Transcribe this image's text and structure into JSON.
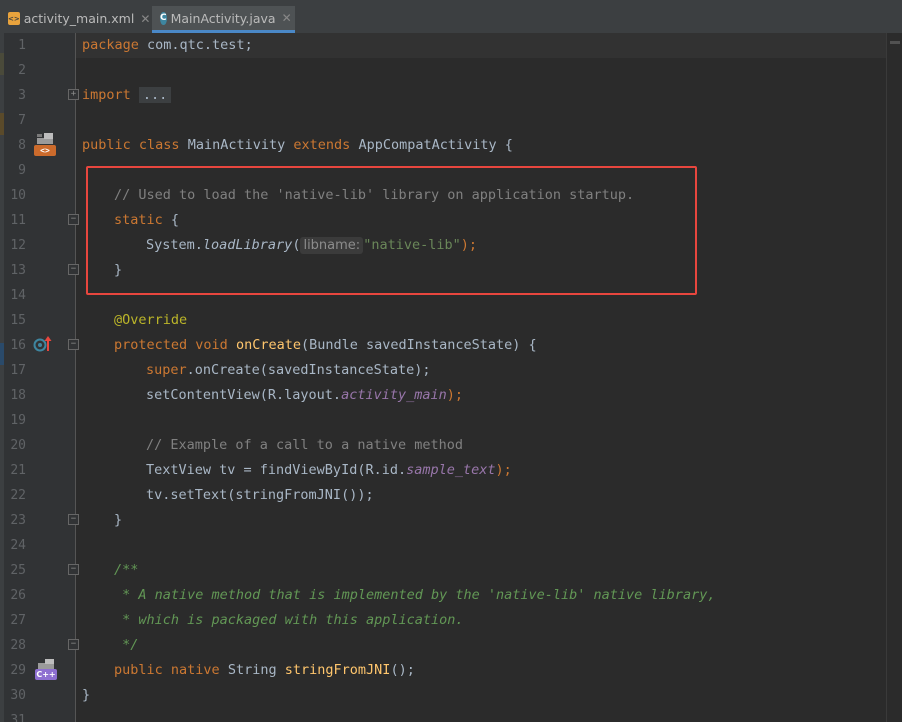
{
  "tabs": [
    {
      "label": "activity_main.xml",
      "icon": "xml-file-icon",
      "active": false
    },
    {
      "label": "MainActivity.java",
      "icon": "java-class-icon",
      "active": true
    }
  ],
  "line_numbers": [
    "1",
    "2",
    "3",
    "7",
    "8",
    "9",
    "10",
    "11",
    "12",
    "13",
    "14",
    "15",
    "16",
    "17",
    "18",
    "19",
    "20",
    "21",
    "22",
    "23",
    "24",
    "25",
    "26",
    "27",
    "28",
    "29",
    "30",
    "31"
  ],
  "code": {
    "l1": {
      "kw": "package",
      "rest": " com.qtc.test;"
    },
    "l3": {
      "kw": "import",
      "fold": "..."
    },
    "l8": {
      "kw1": "public",
      "kw2": "class",
      "name": "MainActivity",
      "kw3": "extends",
      "parent": "AppCompatActivity",
      "brace": " {"
    },
    "l10": {
      "comment": "// Used to load the 'native-lib' library on application startup."
    },
    "l11": {
      "kw": "static",
      "rest": " {"
    },
    "l12": {
      "obj": "System.",
      "method": "loadLibrary",
      "open": "(",
      "hint": "libname:",
      "arg": "\"native-lib\"",
      "close": ");"
    },
    "l13": {
      "text": "}"
    },
    "l15": {
      "ann": "@Override"
    },
    "l16": {
      "kw1": "protected",
      "kw2": "void",
      "fn": "onCreate",
      "rest": "(Bundle savedInstanceState) {"
    },
    "l17": {
      "kw": "super",
      "rest": ".onCreate(savedInstanceState);"
    },
    "l18": {
      "pre": "setContentView(R.layout.",
      "field": "activity_main",
      "post": ");"
    },
    "l20": {
      "comment": "// Example of a call to a native method"
    },
    "l21": {
      "pre": "TextView tv = findViewById(R.id.",
      "field": "sample_text",
      "post": ");"
    },
    "l22": {
      "text": "tv.setText(stringFromJNI());"
    },
    "l23": {
      "text": "}"
    },
    "l25": {
      "doc": "/**"
    },
    "l26": {
      "doc": " * A native method that is implemented by the 'native-lib' native library,"
    },
    "l27": {
      "doc": " * which is packaged with this application."
    },
    "l28": {
      "doc": " */"
    },
    "l29": {
      "kw1": "public",
      "kw2": "native",
      "type": "String",
      "fn": "stringFromJNI",
      "rest": "();"
    },
    "l30": {
      "text": "}"
    }
  },
  "gutter_icons": {
    "l8": {
      "icon": "android-activity-icon",
      "badge": "<>"
    },
    "l16": {
      "icon": "override-method-icon"
    },
    "l29": {
      "icon": "native-cpp-icon",
      "badge": "C++"
    }
  },
  "colors": {
    "keyword": "#cc7832",
    "annotation": "#bbb529",
    "comment": "#808080",
    "doc_comment": "#629755",
    "string": "#6a8759",
    "method_decl": "#ffc66d",
    "static_field": "#9876aa",
    "highlight_box": "#e8463e"
  }
}
